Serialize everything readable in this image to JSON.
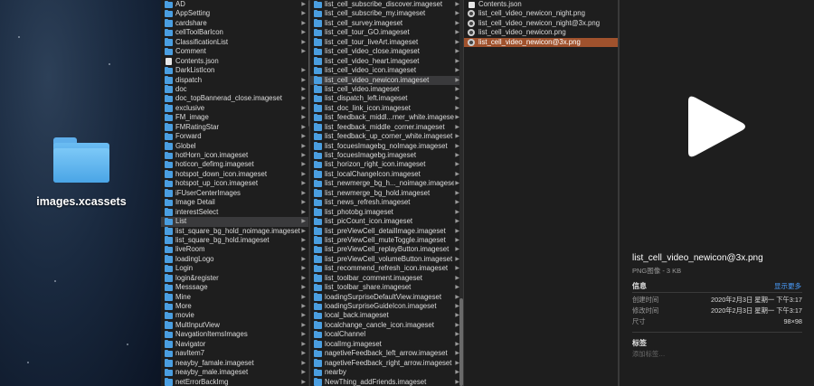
{
  "desktop": {
    "folder_label": "images.xcassets"
  },
  "column1": {
    "items": [
      {
        "label": "AD",
        "icon": "folder"
      },
      {
        "label": "AppSetting",
        "icon": "folder"
      },
      {
        "label": "cardshare",
        "icon": "folder"
      },
      {
        "label": "cellToolBarIcon",
        "icon": "folder"
      },
      {
        "label": "ClassificationList",
        "icon": "folder"
      },
      {
        "label": "Comment",
        "icon": "folder"
      },
      {
        "label": "Contents.json",
        "icon": "file"
      },
      {
        "label": "DarkListIcon",
        "icon": "folder"
      },
      {
        "label": "dispatch",
        "icon": "folder"
      },
      {
        "label": "doc",
        "icon": "folder"
      },
      {
        "label": "doc_topBannerad_close.imageset",
        "icon": "folder"
      },
      {
        "label": "exclusive",
        "icon": "folder"
      },
      {
        "label": "FM_image",
        "icon": "folder"
      },
      {
        "label": "FMRatingStar",
        "icon": "folder"
      },
      {
        "label": "Forward",
        "icon": "folder"
      },
      {
        "label": "Globel",
        "icon": "folder"
      },
      {
        "label": "hotHorn_icon.imageset",
        "icon": "folder"
      },
      {
        "label": "hoticon_defimg.imageset",
        "icon": "folder"
      },
      {
        "label": "hotspot_down_icon.imageset",
        "icon": "folder"
      },
      {
        "label": "hotspot_up_icon.imageset",
        "icon": "folder"
      },
      {
        "label": "iFUserCenterImages",
        "icon": "folder"
      },
      {
        "label": "Image Detail",
        "icon": "folder"
      },
      {
        "label": "interestSelect",
        "icon": "folder"
      },
      {
        "label": "List",
        "icon": "folder",
        "selected": true
      },
      {
        "label": "list_square_bg_hold_noimage.imageset",
        "icon": "folder"
      },
      {
        "label": "list_square_bg_hold.imageset",
        "icon": "folder"
      },
      {
        "label": "liveRoom",
        "icon": "folder"
      },
      {
        "label": "loadingLogo",
        "icon": "folder"
      },
      {
        "label": "Login",
        "icon": "folder"
      },
      {
        "label": "login&register",
        "icon": "folder"
      },
      {
        "label": "Messsage",
        "icon": "folder"
      },
      {
        "label": "Mine",
        "icon": "folder"
      },
      {
        "label": "More",
        "icon": "folder"
      },
      {
        "label": "movie",
        "icon": "folder"
      },
      {
        "label": "MultInputView",
        "icon": "folder"
      },
      {
        "label": "NavgationItemsImages",
        "icon": "folder"
      },
      {
        "label": "Navigator",
        "icon": "folder"
      },
      {
        "label": "navItem7",
        "icon": "folder"
      },
      {
        "label": "neayby_famale.imageset",
        "icon": "folder"
      },
      {
        "label": "neayby_male.imageset",
        "icon": "folder"
      },
      {
        "label": "netErrorBackImg",
        "icon": "folder"
      }
    ]
  },
  "column2": {
    "items": [
      {
        "label": "list_cell_subscribe_discover.imageset"
      },
      {
        "label": "list_cell_subscribe_my.imageset"
      },
      {
        "label": "list_cell_survey.imageset"
      },
      {
        "label": "list_cell_tour_GO.imageset"
      },
      {
        "label": "list_cell_tour_liveArt.imageset"
      },
      {
        "label": "list_cell_video_close.imageset"
      },
      {
        "label": "list_cell_video_heart.imageset"
      },
      {
        "label": "list_cell_video_icon.imageset"
      },
      {
        "label": "list_cell_video_newicon.imageset",
        "selected": true
      },
      {
        "label": "list_cell_video.imageset"
      },
      {
        "label": "list_dispatch_left.imageset"
      },
      {
        "label": "list_doc_link_icon.imageset"
      },
      {
        "label": "list_feedback_middl...rner_white.imageset"
      },
      {
        "label": "list_feedback_middle_corner.imageset"
      },
      {
        "label": "list_feedback_up_corner_white.imageset"
      },
      {
        "label": "list_focuesImagebg_noImage.imageset"
      },
      {
        "label": "list_focuesImagebg.imageset"
      },
      {
        "label": "list_horizon_right_icon.imageset"
      },
      {
        "label": "list_localChangeIcon.imageset"
      },
      {
        "label": "list_newmerge_bg_h..._noimage.imageset"
      },
      {
        "label": "list_newmerge_bg_hold.imageset"
      },
      {
        "label": "list_news_refresh.imageset"
      },
      {
        "label": "list_photobg.imageset"
      },
      {
        "label": "list_picCount_icon.imageset"
      },
      {
        "label": "list_preViewCell_detailImage.imageset"
      },
      {
        "label": "list_preViewCell_muteToggle.imageset"
      },
      {
        "label": "list_preViewCell_replayButton.imageset"
      },
      {
        "label": "list_preViewCell_volumeButton.imageset"
      },
      {
        "label": "list_recommend_refresh_icon.imageset"
      },
      {
        "label": "list_toolbar_comment.imageset"
      },
      {
        "label": "list_toolbar_share.imageset"
      },
      {
        "label": "loadingSurpriseDefaultView.imageset"
      },
      {
        "label": "loadingSurpriseGuideIcon.imageset"
      },
      {
        "label": "local_back.imageset"
      },
      {
        "label": "localchange_cancle_icon.imageset"
      },
      {
        "label": "localChannel"
      },
      {
        "label": "localImg.imageset"
      },
      {
        "label": "nagetiveFeedback_left_arrow.imageset"
      },
      {
        "label": "nagetiveFeedback_right_arrow.imageset"
      },
      {
        "label": "nearby"
      },
      {
        "label": "NewThing_addFriends.imageset"
      }
    ]
  },
  "column3": {
    "items": [
      {
        "label": "Contents.json",
        "icon": "file"
      },
      {
        "label": "list_cell_video_newicon_night.png",
        "icon": "image"
      },
      {
        "label": "list_cell_video_newicon_night@3x.png",
        "icon": "image"
      },
      {
        "label": "list_cell_video_newicon.png",
        "icon": "image"
      },
      {
        "label": "list_cell_video_newicon@3x.png",
        "icon": "image",
        "selected": true
      }
    ]
  },
  "preview": {
    "title": "list_cell_video_newicon@3x.png",
    "subtitle": "PNG图像 - 3 KB",
    "info_heading": "信息",
    "more_label": "显示更多",
    "info_rows": [
      {
        "key": "创建时间",
        "value": "2020年2月3日 星期一 下午3:17"
      },
      {
        "key": "修改时间",
        "value": "2020年2月3日 星期一 下午3:17"
      },
      {
        "key": "尺寸",
        "value": "98×98"
      }
    ],
    "tags_heading": "标签",
    "tags_placeholder": "添加标签…"
  },
  "colors": {
    "selection_active": "#a0522d",
    "selection_inactive": "#3a3a3c",
    "folder_blue": "#4a9ee0",
    "link_blue": "#4a9eff"
  }
}
